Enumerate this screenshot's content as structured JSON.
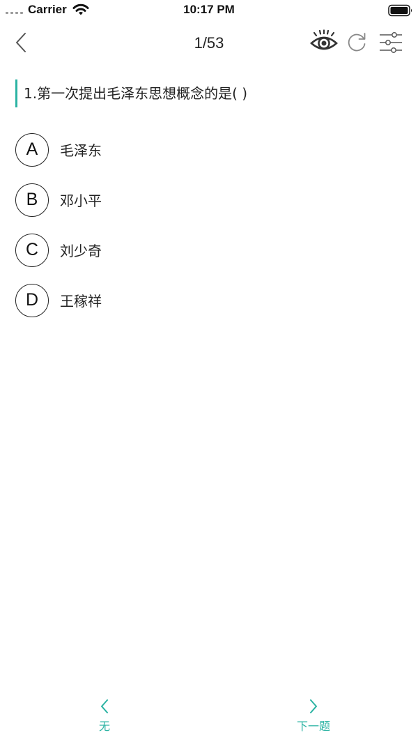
{
  "status_bar": {
    "carrier": "Carrier",
    "time": "10:17 PM",
    "icons": [
      "signal-dots-icon",
      "wifi-icon",
      "battery-icon"
    ]
  },
  "nav": {
    "counter": "1/53",
    "icons": [
      "chevron-left-icon",
      "eye-icon",
      "refresh-icon",
      "sliders-icon"
    ]
  },
  "question": {
    "text": "1.第一次提出毛泽东思想概念的是( )"
  },
  "options": [
    {
      "letter": "A",
      "text": "毛泽东"
    },
    {
      "letter": "B",
      "text": "邓小平"
    },
    {
      "letter": "C",
      "text": "刘少奇"
    },
    {
      "letter": "D",
      "text": "王稼祥"
    }
  ],
  "bottom": {
    "prev_label": "无",
    "next_label": "下一题"
  },
  "colors": {
    "accent": "#2bb3a3",
    "text": "#222222",
    "background": "#ffffff"
  }
}
